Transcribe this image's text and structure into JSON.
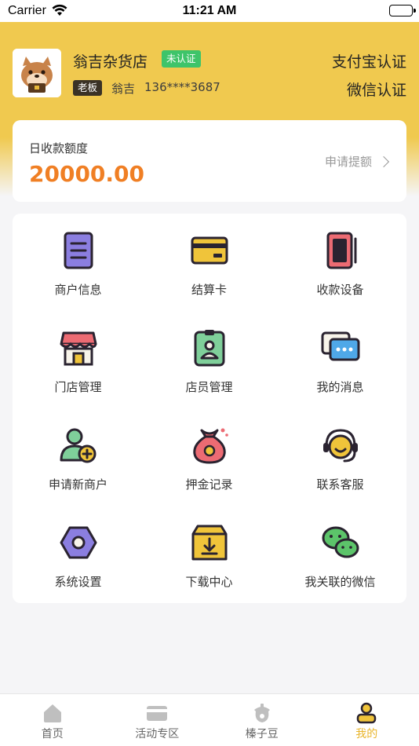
{
  "status_bar": {
    "carrier": "Carrier",
    "time": "11:21 AM"
  },
  "header": {
    "store_name": "翁吉杂货店",
    "verification_badge": "未认证",
    "role_badge": "老板",
    "owner_name": "翁吉",
    "owner_phone": "136****3687",
    "alipay_link": "支付宝认证",
    "wechat_link": "微信认证"
  },
  "limit_card": {
    "label": "日收款额度",
    "value": "20000.00",
    "apply_link": "申请提额"
  },
  "menu": {
    "items": [
      {
        "label": "商户信息",
        "icon": "merchant-info-icon"
      },
      {
        "label": "结算卡",
        "icon": "bank-card-icon"
      },
      {
        "label": "收款设备",
        "icon": "payment-device-icon"
      },
      {
        "label": "门店管理",
        "icon": "store-icon"
      },
      {
        "label": "店员管理",
        "icon": "staff-badge-icon"
      },
      {
        "label": "我的消息",
        "icon": "message-icon"
      },
      {
        "label": "申请新商户",
        "icon": "add-user-icon"
      },
      {
        "label": "押金记录",
        "icon": "money-bag-icon"
      },
      {
        "label": "联系客服",
        "icon": "headset-icon"
      },
      {
        "label": "系统设置",
        "icon": "settings-icon"
      },
      {
        "label": "下载中心",
        "icon": "download-icon"
      },
      {
        "label": "我关联的微信",
        "icon": "wechat-icon"
      }
    ]
  },
  "tab_bar": {
    "tabs": [
      {
        "label": "首页",
        "icon": "home-icon"
      },
      {
        "label": "活动专区",
        "icon": "card-icon"
      },
      {
        "label": "榛子豆",
        "icon": "hazelnut-icon"
      },
      {
        "label": "我的",
        "icon": "profile-icon"
      }
    ],
    "active": "我的"
  },
  "colors": {
    "brand_yellow": "#f0c94f",
    "accent_orange": "#f07f24",
    "badge_green": "#3ec46a",
    "active_tab": "#e9b52b"
  }
}
